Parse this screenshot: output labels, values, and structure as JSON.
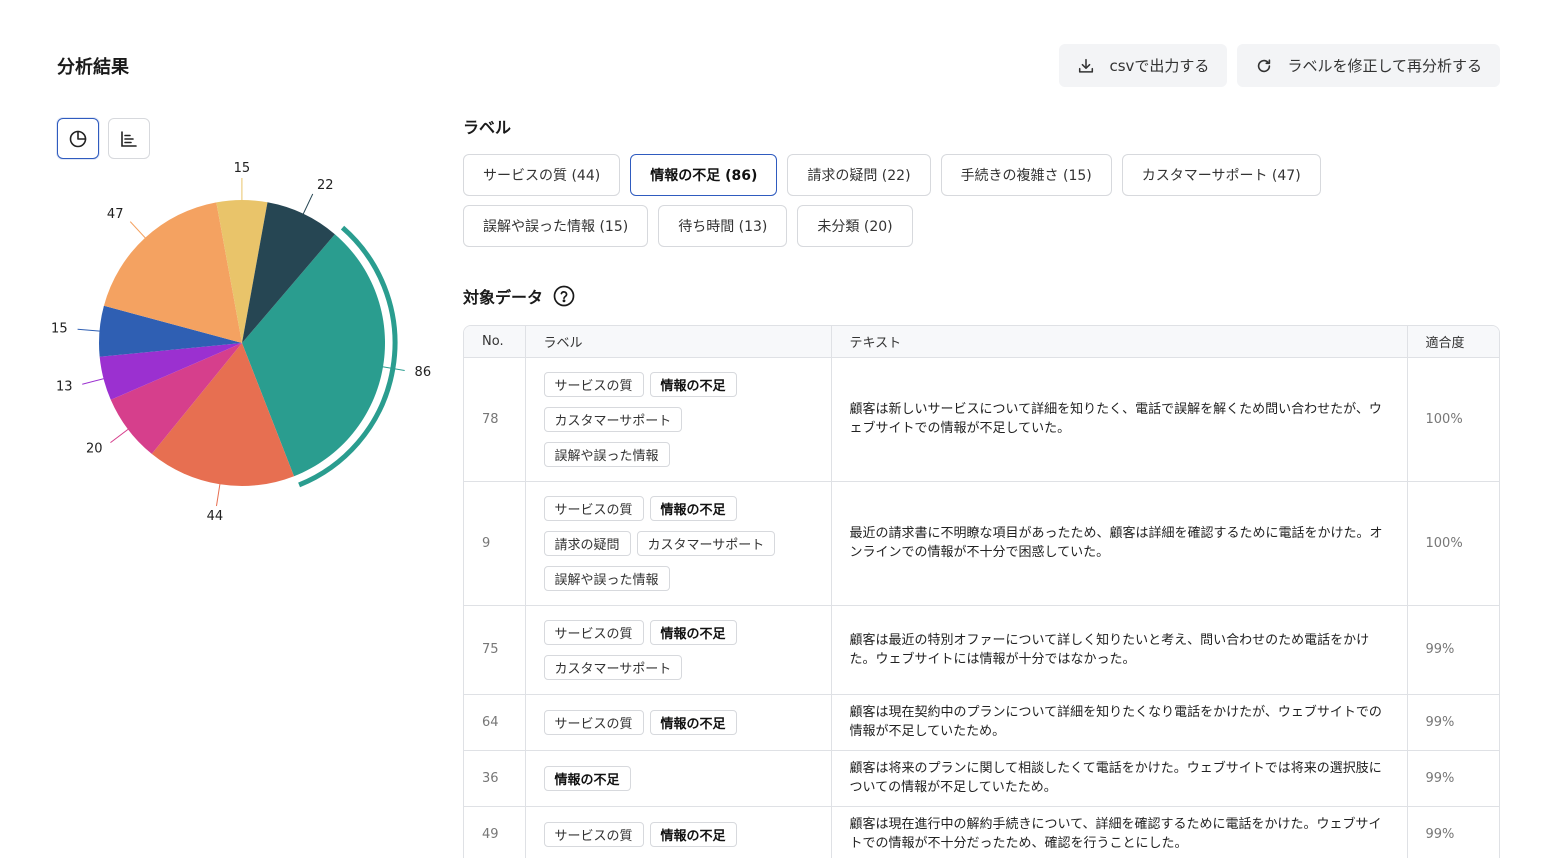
{
  "page": {
    "title": "分析結果"
  },
  "actions": {
    "export_label": "csvで出力する",
    "reanalyze_label": "ラベルを修正して再分析する"
  },
  "labels_section": {
    "title": "ラベル",
    "chips": [
      {
        "label": "サービスの質 (44)",
        "selected": false
      },
      {
        "label": "情報の不足 (86)",
        "selected": true
      },
      {
        "label": "請求の疑問 (22)",
        "selected": false
      },
      {
        "label": "手続きの複雑さ (15)",
        "selected": false
      },
      {
        "label": "カスタマーサポート (47)",
        "selected": false
      },
      {
        "label": "誤解や誤った情報 (15)",
        "selected": false
      },
      {
        "label": "待ち時間 (13)",
        "selected": false
      },
      {
        "label": "未分類 (20)",
        "selected": false
      }
    ]
  },
  "data_section": {
    "title": "対象データ",
    "columns": {
      "no": "No.",
      "label": "ラベル",
      "text": "テキスト",
      "score": "適合度"
    },
    "rows": [
      {
        "no": "78",
        "tags": [
          "サービスの質",
          "情報の不足",
          "カスタマーサポート",
          "誤解や誤った情報"
        ],
        "text": "顧客は新しいサービスについて詳細を知りたく、電話で誤解を解くため問い合わせたが、ウェブサイトでの情報が不足していた。",
        "score": "100%"
      },
      {
        "no": "9",
        "tags": [
          "サービスの質",
          "情報の不足",
          "請求の疑問",
          "カスタマーサポート",
          "誤解や誤った情報"
        ],
        "text": "最近の請求書に不明瞭な項目があったため、顧客は詳細を確認するために電話をかけた。オンラインでの情報が不十分で困惑していた。",
        "score": "100%"
      },
      {
        "no": "75",
        "tags": [
          "サービスの質",
          "情報の不足",
          "カスタマーサポート"
        ],
        "text": "顧客は最近の特別オファーについて詳しく知りたいと考え、問い合わせのため電話をかけた。ウェブサイトには情報が十分ではなかった。",
        "score": "99%"
      },
      {
        "no": "64",
        "tags": [
          "サービスの質",
          "情報の不足"
        ],
        "text": "顧客は現在契約中のプランについて詳細を知りたくなり電話をかけたが、ウェブサイトでの情報が不足していたため。",
        "score": "99%"
      },
      {
        "no": "36",
        "tags": [
          "情報の不足"
        ],
        "text": "顧客は将来のプランに関して相談したくて電話をかけた。ウェブサイトでは将来の選択肢についての情報が不足していたため。",
        "score": "99%"
      },
      {
        "no": "49",
        "tags": [
          "サービスの質",
          "情報の不足"
        ],
        "text": "顧客は現在進行中の解約手続きについて、詳細を確認するために電話をかけた。ウェブサイトでの情報が不十分だったため、確認を行うことにした。",
        "score": "99%"
      }
    ]
  },
  "highlight_tag": "情報の不足",
  "chart_data": {
    "type": "pie",
    "highlighted": "情報の不足",
    "slices": [
      {
        "name": "情報の不足",
        "value": 86,
        "color": "#2a9d8f"
      },
      {
        "name": "サービスの質",
        "value": 44,
        "color": "#e76f51"
      },
      {
        "name": "未分類",
        "value": 20,
        "color": "#d63f8c"
      },
      {
        "name": "待ち時間",
        "value": 13,
        "color": "#9b30d0"
      },
      {
        "name": "誤解や誤った情報",
        "value": 15,
        "color": "#2f5fb3"
      },
      {
        "name": "カスタマーサポート",
        "value": 47,
        "color": "#f4a261"
      },
      {
        "name": "手続きの複雑さ",
        "value": 15,
        "color": "#e9c46a"
      },
      {
        "name": "請求の疑問",
        "value": 22,
        "color": "#264653"
      }
    ]
  },
  "colors": {
    "accent": "#2f5bbf"
  }
}
